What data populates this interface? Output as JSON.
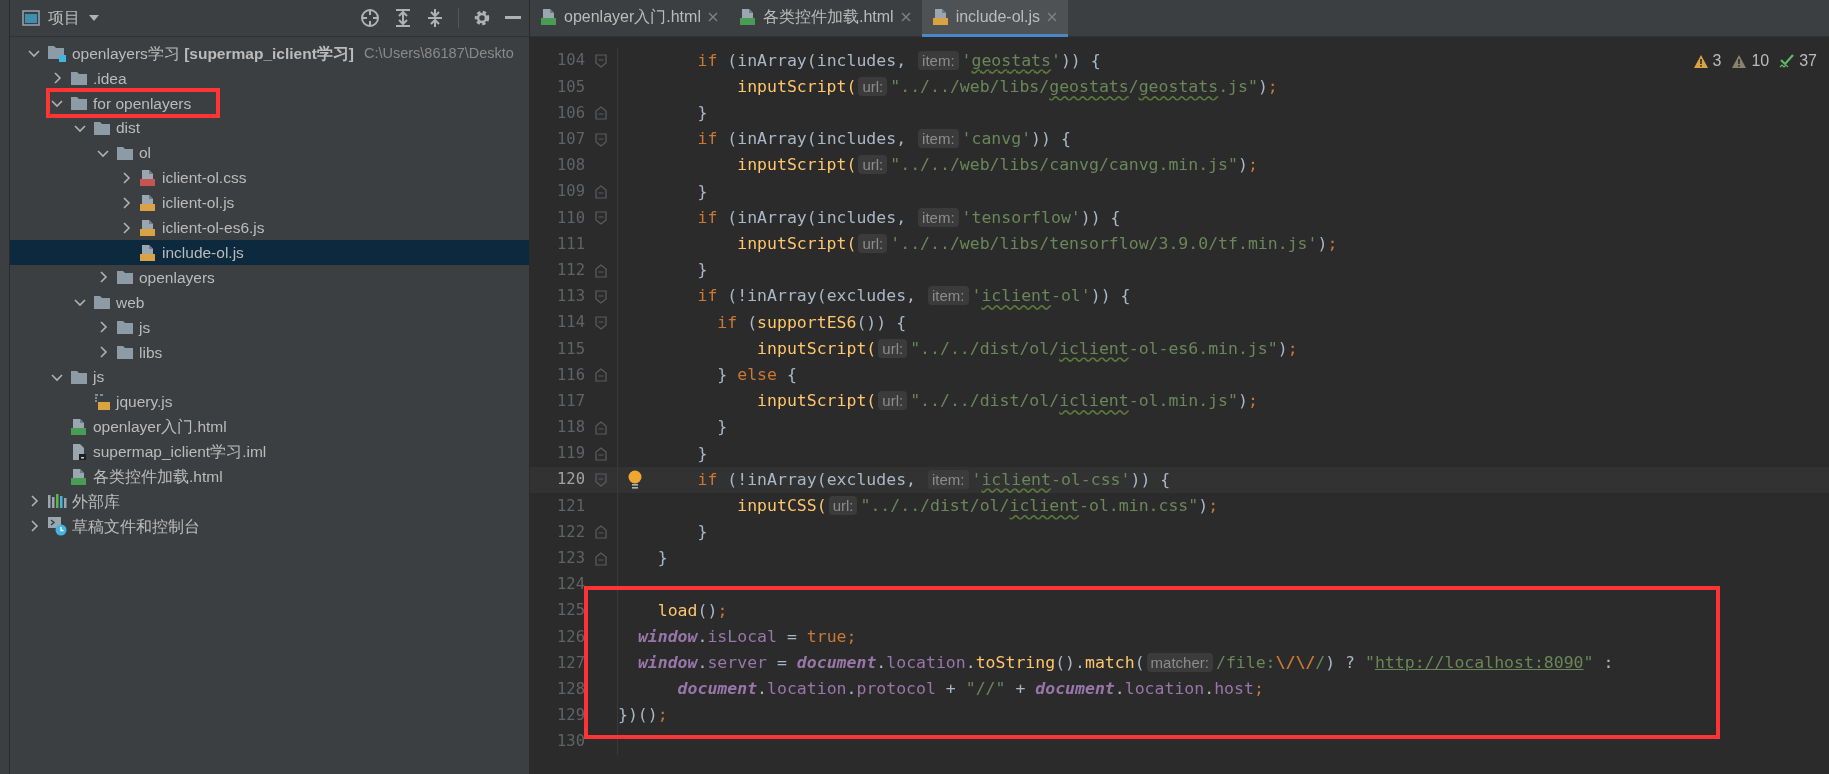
{
  "project_panel": {
    "title": "项目",
    "tree": [
      {
        "label": "openlayers学习 **[supermap_iclient学习]**",
        "path": "C:\\Users\\86187\\Deskto",
        "kind": "module",
        "expanded": true,
        "selected": false,
        "highlighted": false,
        "children": [
          {
            "label": ".idea",
            "kind": "folder",
            "expanded": false,
            "selected": false,
            "highlighted": false
          },
          {
            "label": "for openlayers",
            "kind": "folder",
            "expanded": true,
            "selected": false,
            "highlighted": true,
            "children": [
              {
                "label": "dist",
                "kind": "folder",
                "expanded": true,
                "selected": false,
                "highlighted": false,
                "children": [
                  {
                    "label": "ol",
                    "kind": "folder",
                    "expanded": true,
                    "selected": false,
                    "highlighted": false,
                    "children": [
                      {
                        "label": "iclient-ol.css",
                        "kind": "css",
                        "expanded": false,
                        "selected": false,
                        "highlighted": false
                      },
                      {
                        "label": "iclient-ol.js",
                        "kind": "js",
                        "expanded": false,
                        "selected": false,
                        "highlighted": false
                      },
                      {
                        "label": "iclient-ol-es6.js",
                        "kind": "js",
                        "expanded": false,
                        "selected": false,
                        "highlighted": false
                      },
                      {
                        "label": "include-ol.js",
                        "kind": "js",
                        "selected": true,
                        "highlighted": false
                      }
                    ]
                  },
                  {
                    "label": "openlayers",
                    "kind": "folder",
                    "expanded": false,
                    "selected": false,
                    "highlighted": false
                  }
                ]
              },
              {
                "label": "web",
                "kind": "folder",
                "expanded": true,
                "selected": false,
                "highlighted": false,
                "children": [
                  {
                    "label": "js",
                    "kind": "folder",
                    "expanded": false,
                    "selected": false,
                    "highlighted": false
                  },
                  {
                    "label": "libs",
                    "kind": "folder",
                    "expanded": false,
                    "selected": false,
                    "highlighted": false
                  }
                ]
              }
            ]
          },
          {
            "label": "js",
            "kind": "folder",
            "expanded": true,
            "selected": false,
            "highlighted": false,
            "children": [
              {
                "label": "jquery.js",
                "kind": "jslib",
                "selected": false,
                "highlighted": false
              }
            ]
          },
          {
            "label": "openlayer入门.html",
            "kind": "html",
            "selected": false,
            "highlighted": false
          },
          {
            "label": "supermap_iclient学习.iml",
            "kind": "iml",
            "selected": false,
            "highlighted": false
          },
          {
            "label": "各类控件加载.html",
            "kind": "html",
            "selected": false,
            "highlighted": false
          }
        ]
      },
      {
        "label": "外部库",
        "kind": "library",
        "expanded": false,
        "selected": false,
        "highlighted": false
      },
      {
        "label": "草稿文件和控制台",
        "kind": "scratch",
        "expanded": false,
        "selected": false,
        "highlighted": false
      }
    ]
  },
  "editor": {
    "tabs": [
      {
        "label": "openlayer入门.html",
        "kind": "html",
        "selected": false
      },
      {
        "label": "各类控件加载.html",
        "kind": "html",
        "selected": false
      },
      {
        "label": "include-ol.js",
        "kind": "js",
        "selected": true
      }
    ],
    "inspections": [
      {
        "kind": "error",
        "count": "3"
      },
      {
        "kind": "warning",
        "count": "10"
      },
      {
        "kind": "ok",
        "count": "37"
      }
    ],
    "lines": [
      {
        "number": "104",
        "kind": "open",
        "current": false,
        "annotated": false,
        "tokens": [
          {
            "kind": "k",
            "text": "        if"
          },
          {
            "kind": "p",
            "text": " (inArray(includes, "
          },
          {
            "kind": "h",
            "text": "item:"
          },
          {
            "kind": "s",
            "text": "'"
          },
          {
            "kind": "t",
            "text": "geostats"
          },
          {
            "kind": "s",
            "text": "'"
          },
          {
            "kind": "p",
            "text": ")) {"
          }
        ]
      },
      {
        "number": "105",
        "kind": "plain",
        "current": false,
        "annotated": false,
        "tokens": [
          {
            "kind": "f",
            "text": "            inputScript("
          },
          {
            "kind": "h",
            "text": "url:"
          },
          {
            "kind": "s",
            "text": "\"../../web/libs/"
          },
          {
            "kind": "t",
            "text": "geostats"
          },
          {
            "kind": "s",
            "text": "/"
          },
          {
            "kind": "t",
            "text": "geostats"
          },
          {
            "kind": "s",
            "text": ".js\""
          },
          {
            "kind": "p",
            "text": ")"
          },
          {
            "kind": "c",
            "text": ";"
          }
        ]
      },
      {
        "number": "106",
        "kind": "close",
        "current": false,
        "annotated": false,
        "tokens": [
          {
            "kind": "p",
            "text": "        }"
          }
        ]
      },
      {
        "number": "107",
        "kind": "open",
        "current": false,
        "annotated": false,
        "tokens": [
          {
            "kind": "k",
            "text": "        if"
          },
          {
            "kind": "p",
            "text": " (inArray(includes, "
          },
          {
            "kind": "h",
            "text": "item:"
          },
          {
            "kind": "s",
            "text": "'canvg'"
          },
          {
            "kind": "p",
            "text": ")) {"
          }
        ]
      },
      {
        "number": "108",
        "kind": "plain",
        "current": false,
        "annotated": false,
        "tokens": [
          {
            "kind": "f",
            "text": "            inputScript("
          },
          {
            "kind": "h",
            "text": "url:"
          },
          {
            "kind": "s",
            "text": "\"../../web/libs/canvg/canvg.min.js\""
          },
          {
            "kind": "p",
            "text": ")"
          },
          {
            "kind": "c",
            "text": ";"
          }
        ]
      },
      {
        "number": "109",
        "kind": "close",
        "current": false,
        "annotated": false,
        "tokens": [
          {
            "kind": "p",
            "text": "        }"
          }
        ]
      },
      {
        "number": "110",
        "kind": "open",
        "current": false,
        "annotated": false,
        "tokens": [
          {
            "kind": "k",
            "text": "        if"
          },
          {
            "kind": "p",
            "text": " (inArray(includes, "
          },
          {
            "kind": "h",
            "text": "item:"
          },
          {
            "kind": "s",
            "text": "'tensorflow'"
          },
          {
            "kind": "p",
            "text": ")) {"
          }
        ]
      },
      {
        "number": "111",
        "kind": "plain",
        "current": false,
        "annotated": false,
        "tokens": [
          {
            "kind": "f",
            "text": "            inputScript("
          },
          {
            "kind": "h",
            "text": "url:"
          },
          {
            "kind": "s",
            "text": "'../../web/libs/tensorflow/3.9.0/tf.min.js'"
          },
          {
            "kind": "p",
            "text": ")"
          },
          {
            "kind": "c",
            "text": ";"
          }
        ]
      },
      {
        "number": "112",
        "kind": "close",
        "current": false,
        "annotated": false,
        "tokens": [
          {
            "kind": "p",
            "text": "        }"
          }
        ]
      },
      {
        "number": "113",
        "kind": "open",
        "current": false,
        "annotated": false,
        "tokens": [
          {
            "kind": "k",
            "text": "        if"
          },
          {
            "kind": "p",
            "text": " (!inArray(excludes, "
          },
          {
            "kind": "h",
            "text": "item:"
          },
          {
            "kind": "s",
            "text": "'"
          },
          {
            "kind": "t",
            "text": "iclient"
          },
          {
            "kind": "s",
            "text": "-ol'"
          },
          {
            "kind": "p",
            "text": ")) {"
          }
        ]
      },
      {
        "number": "114",
        "kind": "open",
        "current": false,
        "annotated": false,
        "tokens": [
          {
            "kind": "k",
            "text": "          if"
          },
          {
            "kind": "p",
            "text": " ("
          },
          {
            "kind": "f",
            "text": "supportES6"
          },
          {
            "kind": "p",
            "text": "()) {"
          }
        ]
      },
      {
        "number": "115",
        "kind": "plain",
        "current": false,
        "annotated": false,
        "tokens": [
          {
            "kind": "f",
            "text": "              inputScript("
          },
          {
            "kind": "h",
            "text": "url:"
          },
          {
            "kind": "s",
            "text": "\"../../dist/ol/"
          },
          {
            "kind": "t",
            "text": "iclient"
          },
          {
            "kind": "s",
            "text": "-ol-es6.min.js\""
          },
          {
            "kind": "p",
            "text": ")"
          },
          {
            "kind": "c",
            "text": ";"
          }
        ]
      },
      {
        "number": "116",
        "kind": "close",
        "current": false,
        "annotated": false,
        "tokens": [
          {
            "kind": "p",
            "text": "          } "
          },
          {
            "kind": "k",
            "text": "else"
          },
          {
            "kind": "p",
            "text": " {"
          }
        ]
      },
      {
        "number": "117",
        "kind": "plain",
        "current": false,
        "annotated": false,
        "tokens": [
          {
            "kind": "f",
            "text": "              inputScript("
          },
          {
            "kind": "h",
            "text": "url:"
          },
          {
            "kind": "s",
            "text": "\"../../dist/ol/"
          },
          {
            "kind": "t",
            "text": "iclient"
          },
          {
            "kind": "s",
            "text": "-ol.min.js\""
          },
          {
            "kind": "p",
            "text": ")"
          },
          {
            "kind": "c",
            "text": ";"
          }
        ]
      },
      {
        "number": "118",
        "kind": "close",
        "current": false,
        "annotated": false,
        "tokens": [
          {
            "kind": "p",
            "text": "          }"
          }
        ]
      },
      {
        "number": "119",
        "kind": "close",
        "current": false,
        "annotated": false,
        "tokens": [
          {
            "kind": "p",
            "text": "        }"
          }
        ]
      },
      {
        "number": "120",
        "kind": "open",
        "current": true,
        "annotated": false,
        "tokens": [
          {
            "kind": "k",
            "text": "        if"
          },
          {
            "kind": "p",
            "text": " (!inArray(excludes, "
          },
          {
            "kind": "h",
            "text": "item:"
          },
          {
            "kind": "s",
            "text": "'"
          },
          {
            "kind": "t",
            "text": "iclient"
          },
          {
            "kind": "s",
            "text": "-ol-css'"
          },
          {
            "kind": "p",
            "text": ")) {"
          }
        ]
      },
      {
        "number": "121",
        "kind": "plain",
        "current": false,
        "annotated": false,
        "tokens": [
          {
            "kind": "f",
            "text": "            inputCSS("
          },
          {
            "kind": "h",
            "text": "url:"
          },
          {
            "kind": "s",
            "text": "\"../../dist/ol/"
          },
          {
            "kind": "t",
            "text": "iclient"
          },
          {
            "kind": "s",
            "text": "-ol.min.css\""
          },
          {
            "kind": "p",
            "text": ")"
          },
          {
            "kind": "c",
            "text": ";"
          }
        ]
      },
      {
        "number": "122",
        "kind": "close",
        "current": false,
        "annotated": false,
        "tokens": [
          {
            "kind": "p",
            "text": "        }"
          }
        ]
      },
      {
        "number": "123",
        "kind": "close",
        "current": false,
        "annotated": false,
        "tokens": [
          {
            "kind": "p",
            "text": "    }"
          }
        ]
      },
      {
        "number": "124",
        "kind": "plain",
        "current": false,
        "annotated": false
      },
      {
        "number": "125",
        "kind": "plain",
        "current": false,
        "annotated": true,
        "tokens": [
          {
            "kind": "f",
            "text": "    load"
          },
          {
            "kind": "p",
            "text": "()"
          },
          {
            "kind": "c",
            "text": ";"
          }
        ]
      },
      {
        "number": "126",
        "kind": "plain",
        "current": false,
        "annotated": true,
        "tokens": [
          {
            "kind": "g",
            "text": "  window"
          },
          {
            "kind": "p",
            "text": "."
          },
          {
            "kind": "r",
            "text": "isLocal"
          },
          {
            "kind": "p",
            "text": " = "
          },
          {
            "kind": "k",
            "text": "true"
          },
          {
            "kind": "c",
            "text": ";"
          }
        ]
      },
      {
        "number": "127",
        "kind": "plain",
        "current": false,
        "annotated": true,
        "tokens": [
          {
            "kind": "g",
            "text": "  window"
          },
          {
            "kind": "p",
            "text": "."
          },
          {
            "kind": "r",
            "text": "server"
          },
          {
            "kind": "p",
            "text": " = "
          },
          {
            "kind": "g",
            "text": "document"
          },
          {
            "kind": "p",
            "text": "."
          },
          {
            "kind": "r",
            "text": "location"
          },
          {
            "kind": "p",
            "text": "."
          },
          {
            "kind": "f",
            "text": "toString"
          },
          {
            "kind": "p",
            "text": "()."
          },
          {
            "kind": "f",
            "text": "match"
          },
          {
            "kind": "p",
            "text": "("
          },
          {
            "kind": "h",
            "text": "matcher:"
          },
          {
            "kind": "s",
            "text": "/file:"
          },
          {
            "kind": "e",
            "text": "\\/\\/"
          },
          {
            "kind": "s",
            "text": "/"
          },
          {
            "kind": "p",
            "text": ") ? "
          },
          {
            "kind": "s",
            "text": "\""
          },
          {
            "kind": "u",
            "text": "http://localhost:8090"
          },
          {
            "kind": "s",
            "text": "\""
          },
          {
            "kind": "p",
            "text": " :"
          }
        ]
      },
      {
        "number": "128",
        "kind": "plain",
        "current": false,
        "annotated": true,
        "tokens": [
          {
            "kind": "g",
            "text": "      document"
          },
          {
            "kind": "p",
            "text": "."
          },
          {
            "kind": "r",
            "text": "location"
          },
          {
            "kind": "p",
            "text": "."
          },
          {
            "kind": "r",
            "text": "protocol"
          },
          {
            "kind": "p",
            "text": " + "
          },
          {
            "kind": "s",
            "text": "\"//\""
          },
          {
            "kind": "p",
            "text": " + "
          },
          {
            "kind": "g",
            "text": "document"
          },
          {
            "kind": "p",
            "text": "."
          },
          {
            "kind": "r",
            "text": "location"
          },
          {
            "kind": "p",
            "text": "."
          },
          {
            "kind": "r",
            "text": "host"
          },
          {
            "kind": "c",
            "text": ";"
          }
        ]
      },
      {
        "number": "129",
        "kind": "plain",
        "current": false,
        "annotated": true,
        "tokens": [
          {
            "kind": "p",
            "text": "})()"
          },
          {
            "kind": "c",
            "text": ";"
          }
        ]
      },
      {
        "number": "130",
        "kind": "plain",
        "current": false,
        "annotated": false
      }
    ]
  }
}
